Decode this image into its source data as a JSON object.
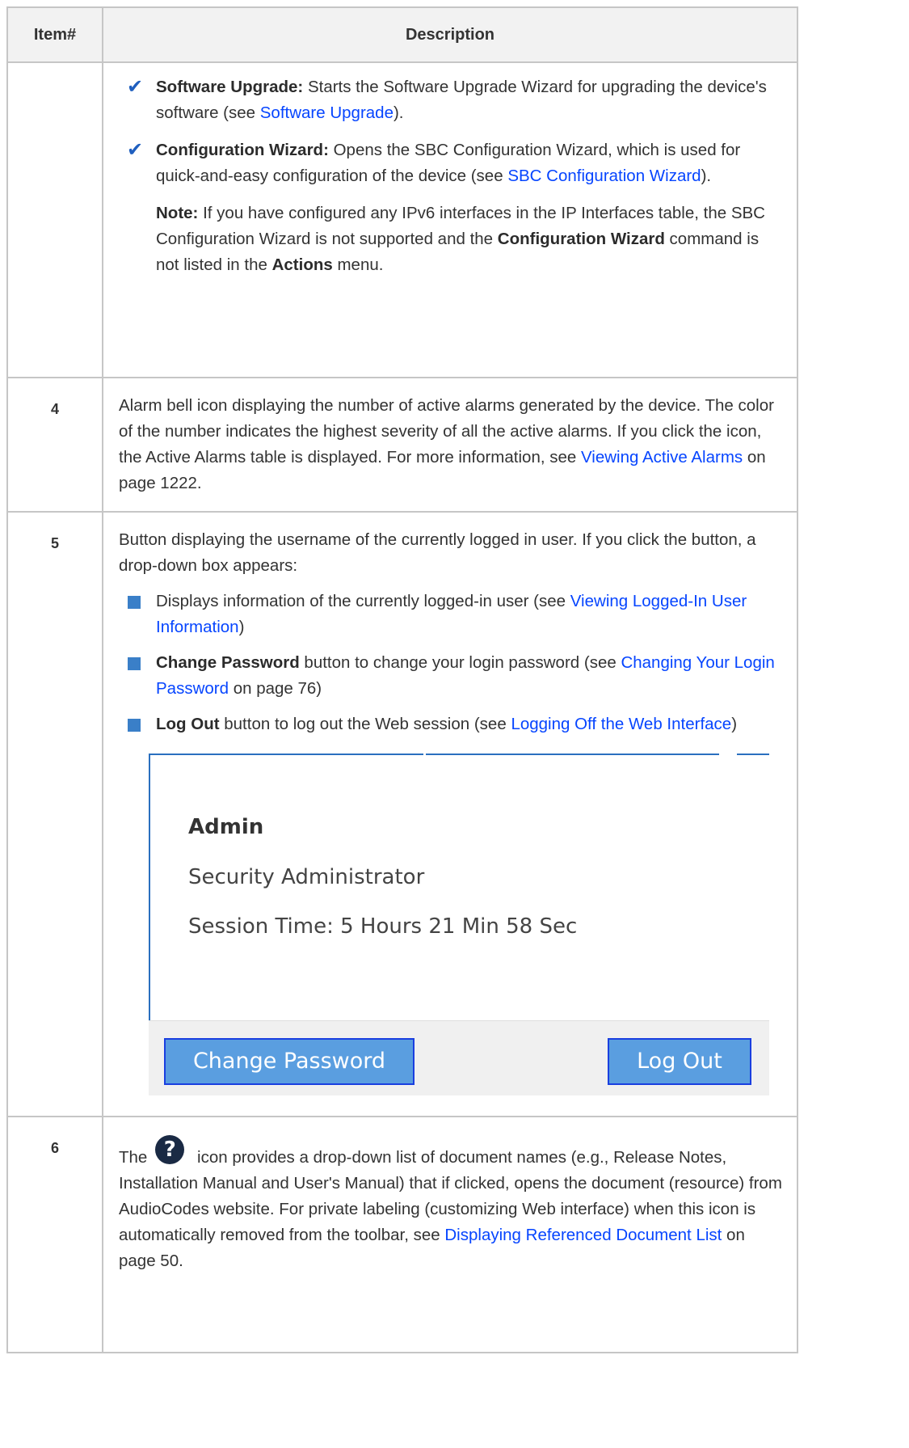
{
  "table": {
    "header_item": "Item#",
    "header_description": "Description"
  },
  "row_cont": {
    "software_upgrade_bold": "Software Upgrade:",
    "software_upgrade_text": " Starts the Software Upgrade Wizard for upgrading the device's software (see ",
    "software_upgrade_link": "Software Upgrade",
    "software_upgrade_end": ").",
    "config_wizard_bold": "Configuration Wizard:",
    "config_wizard_text": " Opens the SBC Configuration Wizard, which is used for quick-and-easy configuration of the device (see ",
    "config_wizard_link": "SBC Configuration Wizard",
    "config_wizard_end": ").",
    "note_bold": "Note:",
    "note_text1": " If you have configured any IPv6 interfaces in the IP Interfaces table, the SBC Configuration Wizard is not supported and the ",
    "note_bold2": "Configuration Wizard",
    "note_text2": " command is not listed in the ",
    "note_bold3": "Actions",
    "note_text3": " menu."
  },
  "row4": {
    "item": "4",
    "text": "Alarm bell icon displaying the number of active alarms generated by the device. The color of the number indicates the highest severity of all the active alarms. If you click the icon, the Active Alarms table is displayed. For more information, see ",
    "link": "Viewing Active Alarms",
    "end": " on page 1222."
  },
  "row5": {
    "item": "5",
    "intro": "Button displaying the username of the currently logged in user. If you click the button, a drop-down box appears:",
    "b1_text": "Displays information of the currently logged-in user (see ",
    "b1_link": "Viewing Logged-In User Information",
    "b1_end": ")",
    "b2_bold": "Change Password",
    "b2_text": " button to change your login password (see ",
    "b2_link": "Changing Your Login Password",
    "b2_end": " on page 76)",
    "b3_bold": "Log Out",
    "b3_text": " button to log out the Web session (see ",
    "b3_link": "Logging Off the Web Interface",
    "b3_end": ")",
    "shot": {
      "user": "Admin",
      "role": "Security Administrator",
      "session": "Session Time: 5 Hours 21 Min 58 Sec",
      "change_password": "Change Password",
      "log_out": "Log Out"
    }
  },
  "row6": {
    "item": "6",
    "pre": "The",
    "icon_glyph": "?",
    "text": " icon provides a drop-down list of document names (e.g., Release Notes, Installation Manual and User's Manual) that if clicked, opens the document (resource) from AudioCodes website. For private labeling (customizing Web interface) when this icon is automatically removed from the toolbar, see ",
    "link": "Displaying Referenced Document List",
    "end": " on page 50."
  },
  "icons": {
    "check": "checkmark-icon",
    "bullet": "square-bullet-icon",
    "help": "help-question-icon"
  },
  "colors": {
    "link": "#0645ff",
    "check": "#1f5fbf",
    "bullet": "#3a7fc8",
    "button_bg": "#5a9ee0",
    "button_border": "#1a3fe0"
  }
}
